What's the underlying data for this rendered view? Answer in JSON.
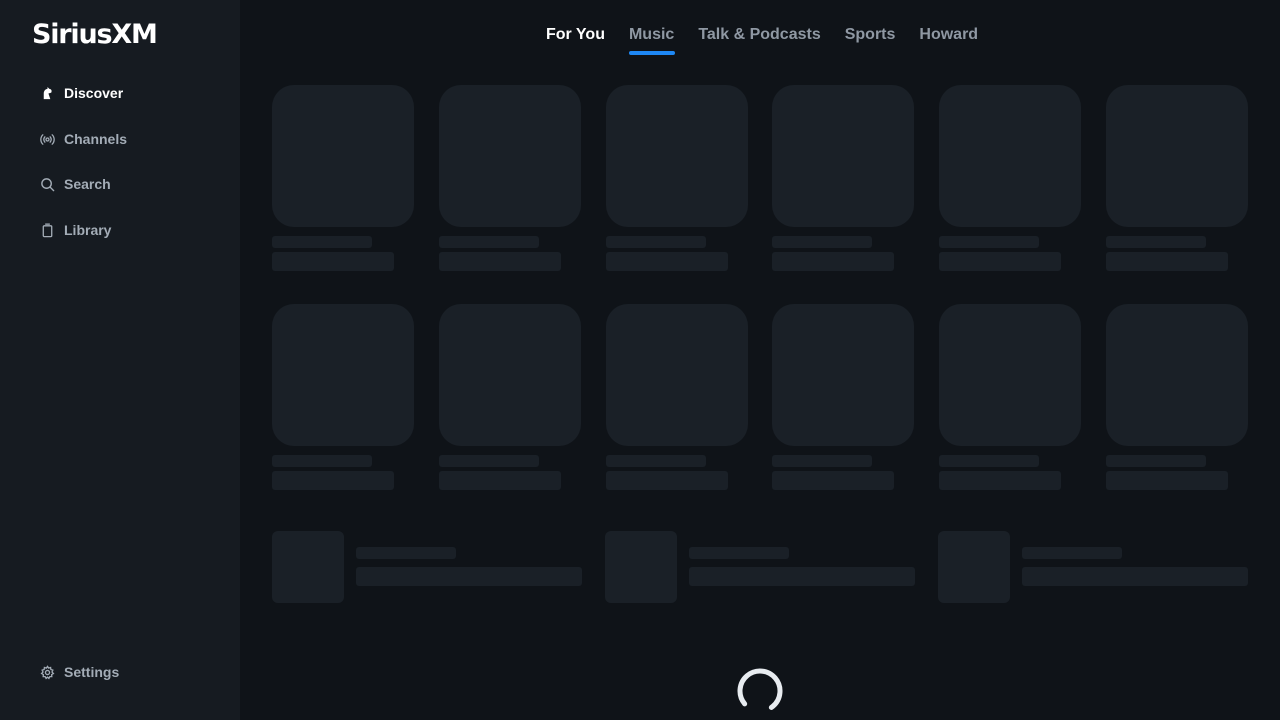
{
  "app": {
    "logo_text": "SiriusXM"
  },
  "sidebar": {
    "items": [
      {
        "label": "Discover",
        "icon": "discover-icon",
        "active": true
      },
      {
        "label": "Channels",
        "icon": "radio-broadcast-icon",
        "active": false
      },
      {
        "label": "Search",
        "icon": "search-icon",
        "active": false
      },
      {
        "label": "Library",
        "icon": "library-icon",
        "active": false
      }
    ],
    "settings": {
      "label": "Settings",
      "icon": "gear-icon"
    }
  },
  "tabs": [
    {
      "label": "For You"
    },
    {
      "label": "Music",
      "selected": true
    },
    {
      "label": "Talk & Podcasts"
    },
    {
      "label": "Sports"
    },
    {
      "label": "Howard"
    }
  ],
  "colors": {
    "accent": "#1e88f5",
    "background": "#0f1318",
    "sidebar": "#161b21",
    "skeleton": "#1a2027"
  },
  "content": {
    "state": "loading"
  }
}
